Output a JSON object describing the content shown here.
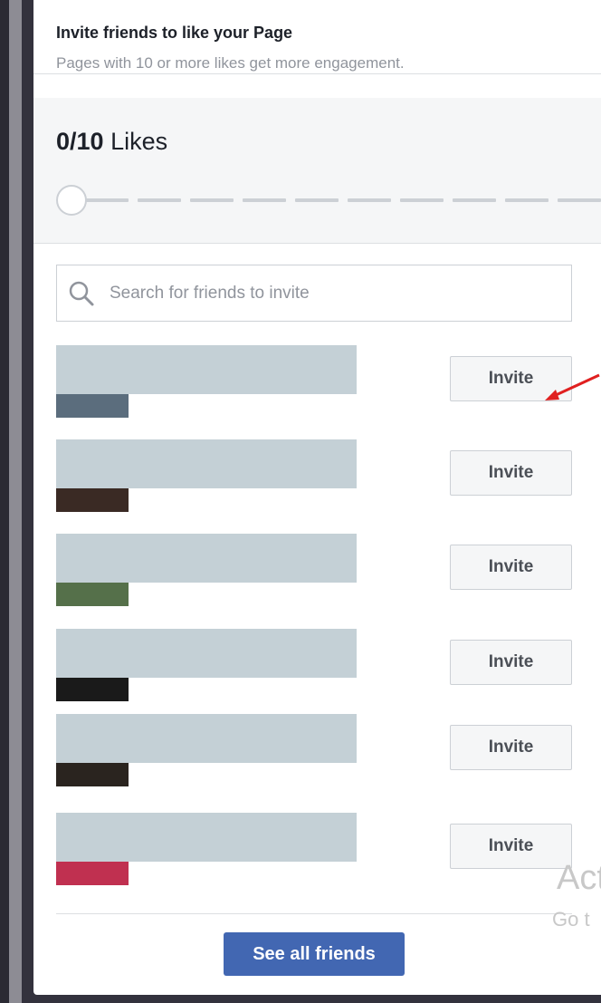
{
  "header": {
    "title": "Invite friends to like your Page",
    "subtitle": "Pages with 10 or more likes get more engagement."
  },
  "progress": {
    "current": 0,
    "goal": 10,
    "count_text": "0/10",
    "unit_text": "Likes"
  },
  "search": {
    "placeholder": "Search for friends to invite",
    "value": ""
  },
  "friends": [
    {
      "invite_label": "Invite"
    },
    {
      "invite_label": "Invite"
    },
    {
      "invite_label": "Invite"
    },
    {
      "invite_label": "Invite"
    },
    {
      "invite_label": "Invite"
    },
    {
      "invite_label": "Invite"
    }
  ],
  "footer": {
    "see_all_label": "See all friends"
  },
  "watermark": {
    "line1": "Act",
    "line2": "Go t"
  },
  "colors": {
    "accent": "#4267b2",
    "background": "#33323d",
    "annotation_arrow": "#e02020"
  },
  "icons": {
    "search": "search-icon",
    "arrow": "red-arrow-annotation-icon"
  }
}
